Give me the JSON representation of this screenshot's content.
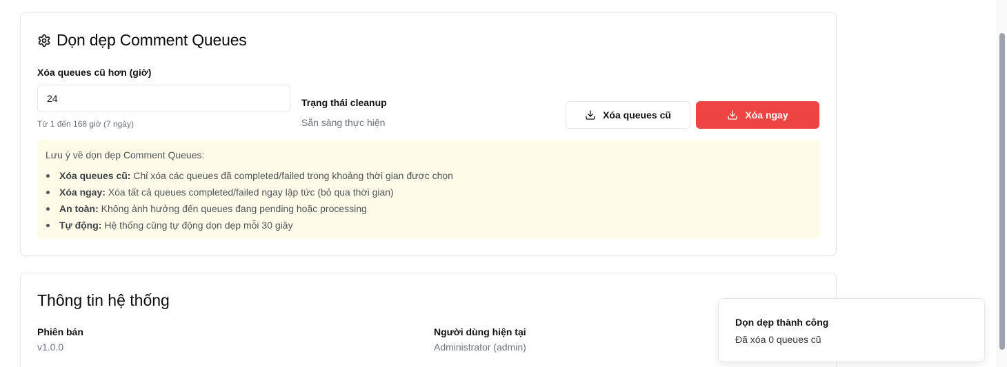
{
  "cleanup": {
    "title": "Dọn dẹp Comment Queues",
    "hours_label": "Xóa queues cũ hơn (giờ)",
    "hours_value": "24",
    "hours_hint": "Từ 1 đến 168 giờ (7 ngày)",
    "status_label": "Trạng thái cleanup",
    "status_value": "Sẵn sàng thực hiện",
    "btn_clean_old": "Xóa queues cũ",
    "btn_clean_now": "Xóa ngay",
    "note_title": "Lưu ý về dọn dẹp Comment Queues:",
    "notes": [
      {
        "term": "Xóa queues cũ:",
        "text": " Chỉ xóa các queues đã completed/failed trong khoảng thời gian được chọn"
      },
      {
        "term": "Xóa ngay:",
        "text": " Xóa tất cả queues completed/failed ngay lập tức (bỏ qua thời gian)"
      },
      {
        "term": "An toàn:",
        "text": " Không ảnh hưởng đến queues đang pending hoặc processing"
      },
      {
        "term": "Tự động:",
        "text": " Hệ thống cũng tự động dọn dẹp mỗi 30 giây"
      }
    ]
  },
  "system": {
    "title": "Thông tin hệ thống",
    "version_label": "Phiên bản",
    "version_value": "v1.0.0",
    "user_label": "Người dùng hiện tại",
    "user_value": "Administrator (admin)"
  },
  "toast": {
    "title": "Dọn dẹp thành công",
    "description": "Đã xóa 0 queues cũ"
  },
  "colors": {
    "danger": "#ef4444",
    "note_bg": "#fefce8",
    "border": "#e5e7eb"
  },
  "icons": {
    "title_icon": "gear-icon",
    "button_icon": "download-icon"
  }
}
